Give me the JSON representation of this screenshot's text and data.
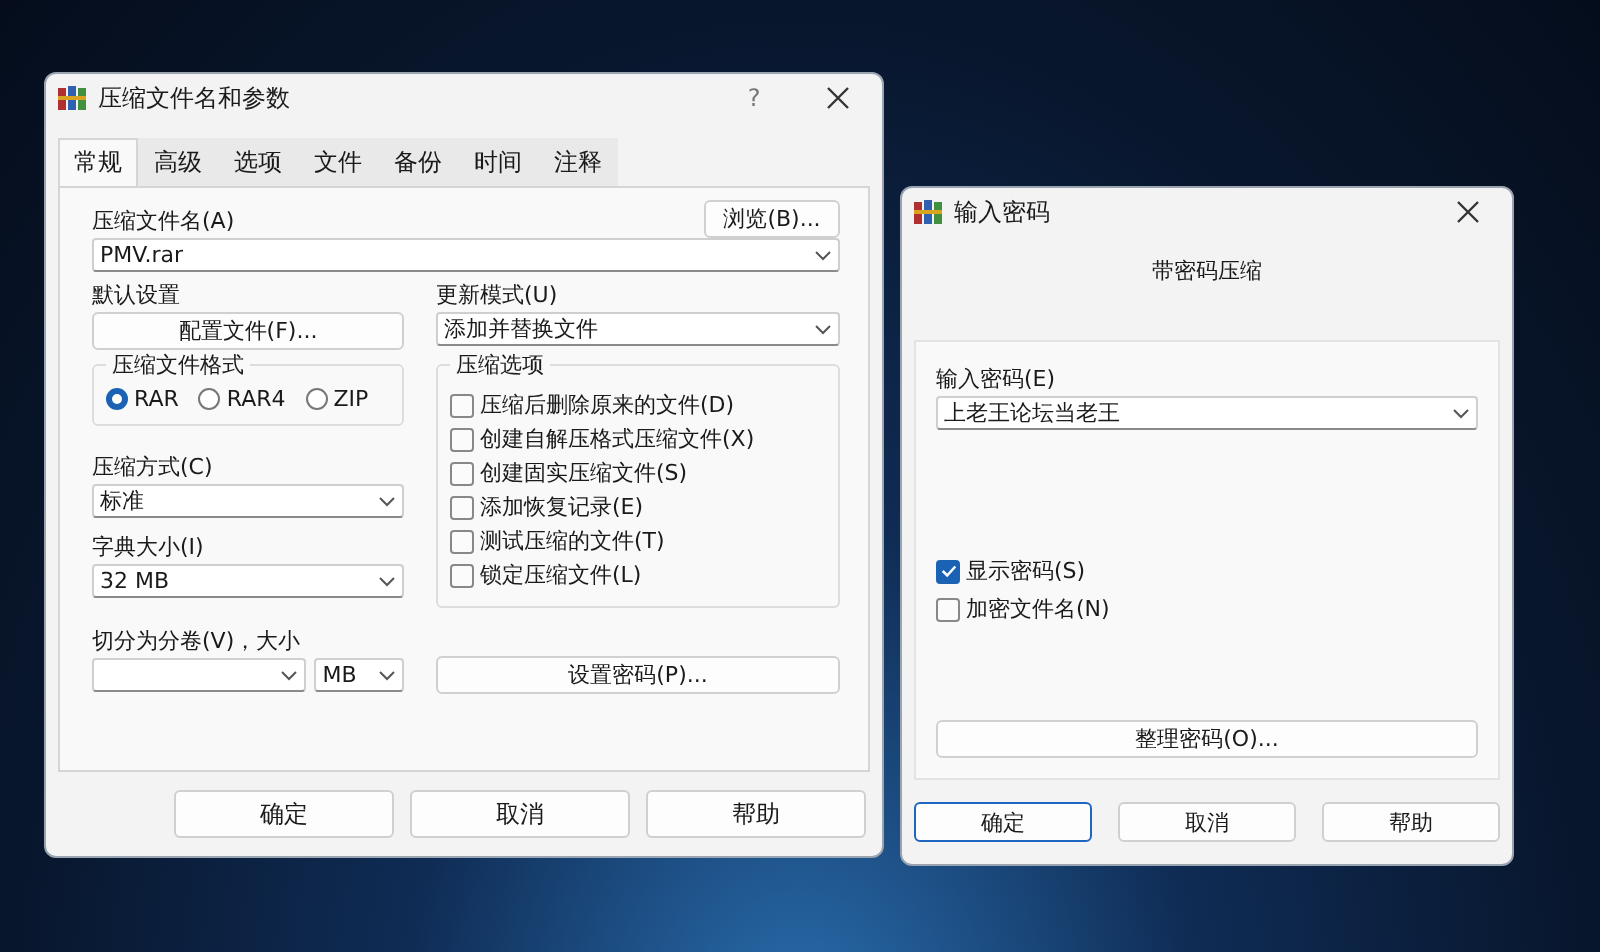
{
  "archive_dialog": {
    "title": "压缩文件名和参数",
    "help_button": "?",
    "tabs": [
      {
        "label": "常规",
        "selected": true
      },
      {
        "label": "高级",
        "selected": false
      },
      {
        "label": "选项",
        "selected": false
      },
      {
        "label": "文件",
        "selected": false
      },
      {
        "label": "备份",
        "selected": false
      },
      {
        "label": "时间",
        "selected": false
      },
      {
        "label": "注释",
        "selected": false
      }
    ],
    "archive_name": {
      "label": "压缩文件名(A)",
      "value": "PMV.rar",
      "browse_button": "浏览(B)..."
    },
    "default_settings": {
      "label": "默认设置",
      "button": "配置文件(F)..."
    },
    "update_mode": {
      "label": "更新模式(U)",
      "value": "添加并替换文件"
    },
    "archive_format": {
      "label": "压缩文件格式",
      "options": [
        {
          "label": "RAR",
          "selected": true
        },
        {
          "label": "RAR4",
          "selected": false
        },
        {
          "label": "ZIP",
          "selected": false
        }
      ]
    },
    "compression_method": {
      "label": "压缩方式(C)",
      "value": "标准"
    },
    "dictionary_size": {
      "label": "字典大小(I)",
      "value": "32 MB"
    },
    "split_volumes": {
      "label": "切分为分卷(V)，大小",
      "unit": "MB"
    },
    "archiving_options": {
      "label": "压缩选项",
      "items": [
        {
          "label": "压缩后删除原来的文件(D)",
          "checked": false
        },
        {
          "label": "创建自解压格式压缩文件(X)",
          "checked": false
        },
        {
          "label": "创建固实压缩文件(S)",
          "checked": false
        },
        {
          "label": "添加恢复记录(E)",
          "checked": false
        },
        {
          "label": "测试压缩的文件(T)",
          "checked": false
        },
        {
          "label": "锁定压缩文件(L)",
          "checked": false
        }
      ]
    },
    "password_button": "设置密码(P)...",
    "buttons": [
      {
        "label": "确定",
        "default": false
      },
      {
        "label": "取消",
        "default": false
      },
      {
        "label": "帮助",
        "default": false
      }
    ]
  },
  "password_dialog": {
    "title": "输入密码",
    "heading": "带密码压缩",
    "password": {
      "label": "输入密码(E)",
      "value": "上老王论坛当老王"
    },
    "options": [
      {
        "label": "显示密码(S)",
        "checked": true
      },
      {
        "label": "加密文件名(N)",
        "checked": false
      }
    ],
    "organize_button": "整理密码(O)...",
    "buttons": [
      {
        "label": "确定",
        "default": true
      },
      {
        "label": "取消",
        "default": false
      },
      {
        "label": "帮助",
        "default": false
      }
    ]
  }
}
